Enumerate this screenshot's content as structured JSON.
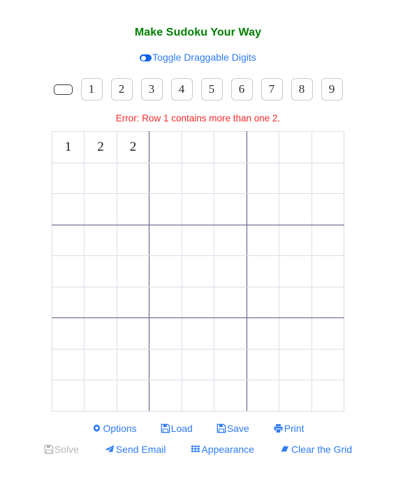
{
  "page": {
    "title": "Make Sudoku Your Way",
    "title_color": "#008000",
    "link_color": "#2e7bf6",
    "error_color": "#fb2a2a",
    "disabled_color": "#b6b6b6",
    "grid_box_color": "#575a80",
    "grid_line_color": "#dcdce9"
  },
  "toggle": {
    "label": "Toggle Draggable Digits",
    "icon": "toggle-switch-icon",
    "state": "on"
  },
  "palette": {
    "blank": {
      "icon": "blank-cell-icon",
      "label": ""
    },
    "digits": [
      "1",
      "2",
      "3",
      "4",
      "5",
      "6",
      "7",
      "8",
      "9"
    ]
  },
  "error": {
    "message": "Error: Row 1 contains more than one 2."
  },
  "grid": {
    "size": 9,
    "cells": [
      [
        "1",
        "2",
        "2",
        "",
        "",
        "",
        "",
        "",
        ""
      ],
      [
        "",
        "",
        "",
        "",
        "",
        "",
        "",
        "",
        ""
      ],
      [
        "",
        "",
        "",
        "",
        "",
        "",
        "",
        "",
        ""
      ],
      [
        "",
        "",
        "",
        "",
        "",
        "",
        "",
        "",
        ""
      ],
      [
        "",
        "",
        "",
        "",
        "",
        "",
        "",
        "",
        ""
      ],
      [
        "",
        "",
        "",
        "",
        "",
        "",
        "",
        "",
        ""
      ],
      [
        "",
        "",
        "",
        "",
        "",
        "",
        "",
        "",
        ""
      ],
      [
        "",
        "",
        "",
        "",
        "",
        "",
        "",
        "",
        ""
      ],
      [
        "",
        "",
        "",
        "",
        "",
        "",
        "",
        "",
        ""
      ]
    ]
  },
  "menu_primary": [
    {
      "label": "Options",
      "icon": "gear-icon",
      "enabled": true
    },
    {
      "label": "Load",
      "icon": "floppy-icon",
      "enabled": true
    },
    {
      "label": "Save",
      "icon": "floppy-icon",
      "enabled": true
    },
    {
      "label": "Print",
      "icon": "printer-icon",
      "enabled": true
    }
  ],
  "menu_secondary": [
    {
      "label": "Solve",
      "icon": "floppy-icon",
      "enabled": false
    },
    {
      "label": "Send Email",
      "icon": "paper-plane-icon",
      "enabled": true
    },
    {
      "label": "Appearance",
      "icon": "grid-dots-icon",
      "enabled": true
    },
    {
      "label": "Clear the Grid",
      "icon": "eraser-icon",
      "enabled": true
    }
  ]
}
